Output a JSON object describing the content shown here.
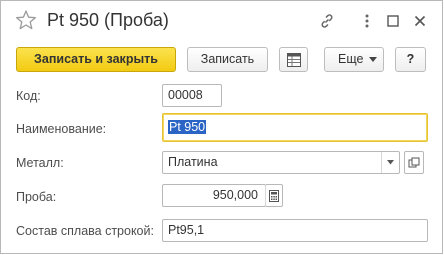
{
  "window": {
    "title": "Pt 950 (Проба)"
  },
  "toolbar": {
    "save_close_label": "Записать и закрыть",
    "save_label": "Записать",
    "more_label": "Еще",
    "help_label": "?"
  },
  "form": {
    "code": {
      "label": "Код:",
      "value": "00008"
    },
    "name": {
      "label": "Наименование:",
      "value": "Pt 950"
    },
    "metal": {
      "label": "Металл:",
      "value": "Платина"
    },
    "assay": {
      "label": "Проба:",
      "value": "950,000"
    },
    "composition": {
      "label": "Состав сплава строкой:",
      "value": "Pt95,1"
    }
  },
  "colors": {
    "primary_button": "#f2cb11",
    "focus_border": "#e8c231",
    "selection": "#2a64c4"
  },
  "icons": [
    "star-icon",
    "link-icon",
    "more-icon",
    "maximize-icon",
    "close-icon",
    "list-grid-icon",
    "dropdown-arrow-icon",
    "open-icon",
    "calculator-icon"
  ]
}
